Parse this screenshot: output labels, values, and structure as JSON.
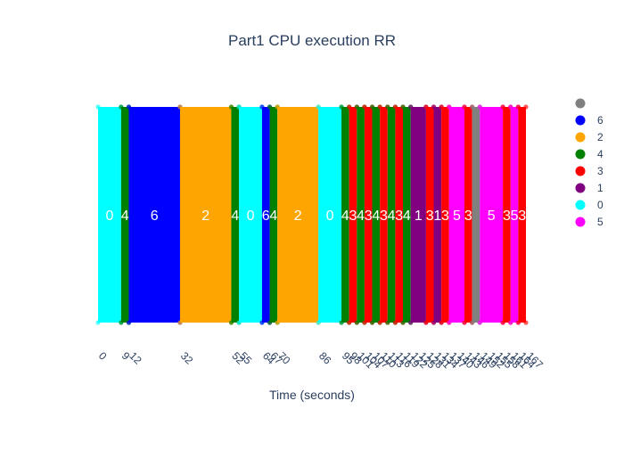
{
  "chart_data": {
    "type": "bar",
    "title": "Part1 CPU execution RR",
    "xlabel": "Time (seconds)",
    "ylabel": "",
    "xlim": [
      0,
      167
    ],
    "x_ticks": [
      "0",
      "9",
      "12",
      "32",
      "52",
      "55",
      "64",
      "67",
      "70",
      "86",
      "95",
      "98",
      "101",
      "104",
      "107",
      "110",
      "113",
      "116",
      "119",
      "122",
      "125",
      "128",
      "131",
      "134",
      "137",
      "140",
      "143",
      "146",
      "149",
      "152",
      "155",
      "158",
      "161",
      "164",
      "167"
    ],
    "legend": {
      "placement": "right",
      "entries": [
        {
          "name": "",
          "color": "#808080"
        },
        {
          "name": "6",
          "color": "#0000ff"
        },
        {
          "name": "2",
          "color": "#ffa500"
        },
        {
          "name": "4",
          "color": "#008000"
        },
        {
          "name": "3",
          "color": "#ff0000"
        },
        {
          "name": "1",
          "color": "#800080"
        },
        {
          "name": "0",
          "color": "#00ffff"
        },
        {
          "name": "5",
          "color": "#ff00ff"
        }
      ]
    },
    "segments": [
      {
        "label": "0",
        "start": 0,
        "end": 9,
        "color": "#00ffff"
      },
      {
        "label": "4",
        "start": 9,
        "end": 12,
        "color": "#008000"
      },
      {
        "label": "6",
        "start": 12,
        "end": 32,
        "color": "#0000ff"
      },
      {
        "label": "2",
        "start": 32,
        "end": 52,
        "color": "#ffa500"
      },
      {
        "label": "4",
        "start": 52,
        "end": 55,
        "color": "#008000"
      },
      {
        "label": "0",
        "start": 55,
        "end": 64,
        "color": "#00ffff"
      },
      {
        "label": "6",
        "start": 64,
        "end": 67,
        "color": "#0000ff"
      },
      {
        "label": "4",
        "start": 67,
        "end": 70,
        "color": "#008000"
      },
      {
        "label": "2",
        "start": 70,
        "end": 86,
        "color": "#ffa500"
      },
      {
        "label": "0",
        "start": 86,
        "end": 95,
        "color": "#00ffff"
      },
      {
        "label": "4",
        "start": 95,
        "end": 98,
        "color": "#008000"
      },
      {
        "label": "3",
        "start": 98,
        "end": 101,
        "color": "#ff0000"
      },
      {
        "label": "4",
        "start": 101,
        "end": 104,
        "color": "#008000"
      },
      {
        "label": "3",
        "start": 104,
        "end": 107,
        "color": "#ff0000"
      },
      {
        "label": "4",
        "start": 107,
        "end": 110,
        "color": "#008000"
      },
      {
        "label": "3",
        "start": 110,
        "end": 113,
        "color": "#ff0000"
      },
      {
        "label": "4",
        "start": 113,
        "end": 116,
        "color": "#008000"
      },
      {
        "label": "3",
        "start": 116,
        "end": 119,
        "color": "#ff0000"
      },
      {
        "label": "4",
        "start": 119,
        "end": 122,
        "color": "#008000"
      },
      {
        "label": "1",
        "start": 122,
        "end": 128,
        "color": "#800080"
      },
      {
        "label": "3",
        "start": 128,
        "end": 131,
        "color": "#ff0000"
      },
      {
        "label": "1",
        "start": 131,
        "end": 134,
        "color": "#800080"
      },
      {
        "label": "3",
        "start": 134,
        "end": 137,
        "color": "#ff0000"
      },
      {
        "label": "5",
        "start": 137,
        "end": 143,
        "color": "#ff00ff"
      },
      {
        "label": "3",
        "start": 143,
        "end": 146,
        "color": "#ff0000"
      },
      {
        "label": "",
        "start": 146,
        "end": 149,
        "color": "#808080"
      },
      {
        "label": "5",
        "start": 149,
        "end": 158,
        "color": "#ff00ff"
      },
      {
        "label": "3",
        "start": 158,
        "end": 161,
        "color": "#ff0000"
      },
      {
        "label": "5",
        "start": 161,
        "end": 164,
        "color": "#ff00ff"
      },
      {
        "label": "3",
        "start": 164,
        "end": 167,
        "color": "#ff0000"
      }
    ]
  }
}
